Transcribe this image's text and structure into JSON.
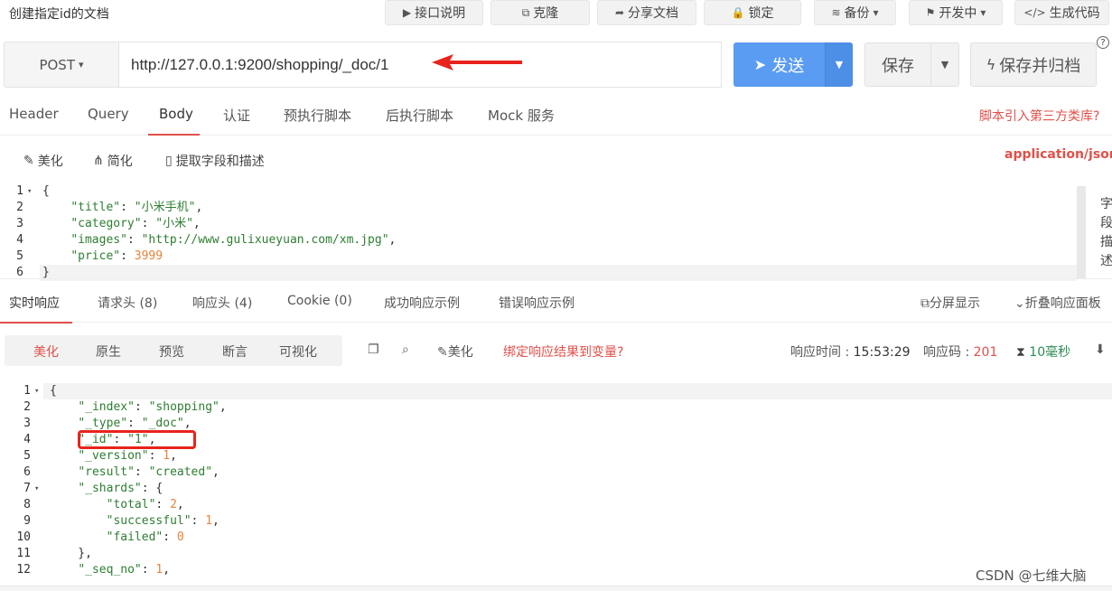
{
  "header": {
    "doc_title": "创建指定id的文档",
    "buttons": [
      {
        "icon": "play-icon",
        "glyph": "▶",
        "label": "接口说明"
      },
      {
        "icon": "clone-icon",
        "glyph": "⧉",
        "label": "克隆"
      },
      {
        "icon": "share-icon",
        "glyph": "➦",
        "label": "分享文档"
      },
      {
        "icon": "lock-icon",
        "glyph": "🔒",
        "label": "锁定"
      },
      {
        "icon": "database-icon",
        "glyph": "≋",
        "label": "备份"
      },
      {
        "icon": "flag-icon",
        "glyph": "⚑",
        "label": "开发中"
      },
      {
        "icon": "code-icon",
        "glyph": "</>",
        "label": "生成代码"
      }
    ]
  },
  "request": {
    "method": "POST",
    "url": "http://127.0.0.1:9200/shopping/_doc/1",
    "send_label": "发送",
    "save_label": "保存",
    "save_all_label": "保存并归档",
    "help": "?"
  },
  "tabs": [
    "Header",
    "Query",
    "Body",
    "认证",
    "预执行脚本",
    "后执行脚本",
    "Mock 服务"
  ],
  "tabs_active": "Body",
  "third_party_link": "脚本引入第三方类库?",
  "body_tools": {
    "beautify": "美化",
    "simplify": "简化",
    "extract": "提取字段和描述"
  },
  "content_type": "application/json",
  "side_text": "字段描述",
  "request_body_lines": [
    "1",
    "2",
    "3",
    "4",
    "5",
    "6"
  ],
  "request_body": {
    "title": "小米手机",
    "category": "小米",
    "images": "http://www.gulixueyuan.com/xm.jpg",
    "price": "3999"
  },
  "response_tabs": [
    "实时响应",
    "请求头 (8)",
    "响应头 (4)",
    "Cookie (0)",
    "成功响应示例",
    "错误响应示例"
  ],
  "response_tools": {
    "split": "分屏显示",
    "fold": "折叠响应面板"
  },
  "view_modes": [
    "美化",
    "原生",
    "预览",
    "断言",
    "可视化"
  ],
  "response_toolbar": {
    "beautify": "美化",
    "bind_var": "绑定响应结果到变量?"
  },
  "response_meta": {
    "time_label": "响应时间 : ",
    "time_value": "15:53:29",
    "code_label": "响应码 : ",
    "code_value": "201",
    "duration": "10毫秒"
  },
  "response_lines": [
    "1",
    "2",
    "3",
    "4",
    "5",
    "6",
    "7",
    "8",
    "9",
    "10",
    "11",
    "12"
  ],
  "response_body": {
    "_index": "shopping",
    "_type": "_doc",
    "_id": "1",
    "_version": "1",
    "result": "created",
    "total": "2",
    "successful": "1",
    "failed": "0",
    "_seq_no": "1"
  },
  "watermark": "CSDN @七维大脑",
  "colors": {
    "accent": "#5a9cf2",
    "red": "#e0504a",
    "annotation": "#e8231c"
  }
}
